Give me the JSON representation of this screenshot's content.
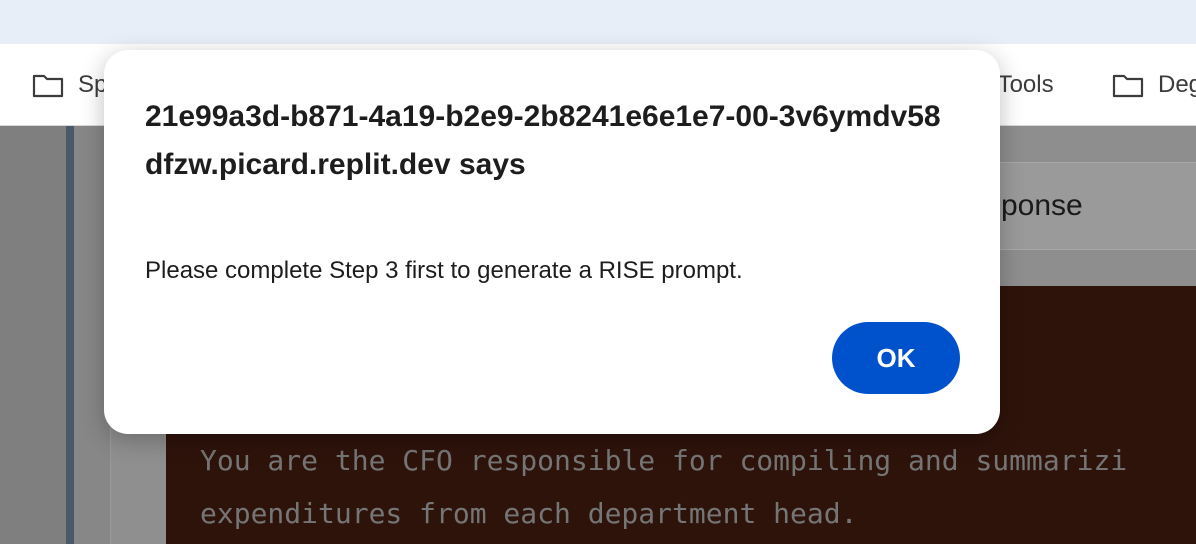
{
  "bookmarks_bar": {
    "items": [
      {
        "label": "Sp",
        "icon": "folder-icon"
      },
      {
        "label": "l Tools",
        "icon": "folder-icon"
      },
      {
        "label": "Deg",
        "icon": "folder-icon"
      }
    ]
  },
  "page": {
    "panel_title": "sponse",
    "code_lines": [
      "You are the CFO responsible for compiling and summarizi",
      "expenditures from each department head."
    ]
  },
  "dialog": {
    "title": "21e99a3d-b871-4a19-b2e9-2b8241e6e1e7-00-3v6ymdv58dfzw.picard.replit.dev says",
    "message": "Please complete Step 3 first to generate a RISE prompt.",
    "ok_label": "OK"
  },
  "colors": {
    "ok_button": "#0052cc",
    "code_background": "#2e130b",
    "tabstrip": "#e8eef8"
  }
}
